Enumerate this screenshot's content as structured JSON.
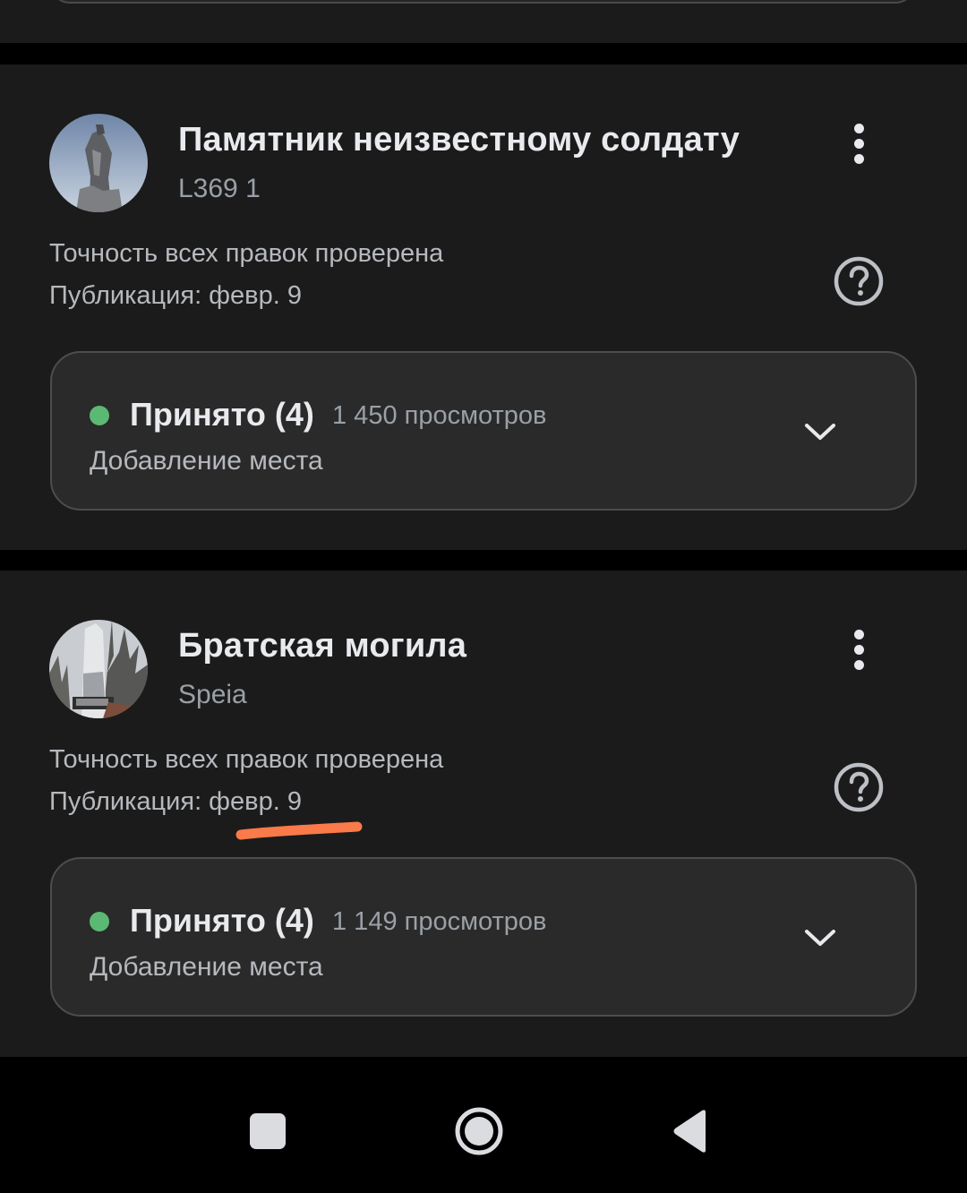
{
  "colors": {
    "background": "#000000",
    "card": "#1b1b1b",
    "status_box": "#2a2a2a",
    "accepted_green": "#5bb974",
    "highlight_orange": "#fa7a4a"
  },
  "places": [
    {
      "title": "Памятник неизвестному солдату",
      "subtitle": "L369 1",
      "accuracy": "Точность всех правок проверена",
      "published": "Публикация: февр. 9",
      "status": "Принято (4)",
      "views": "1 450 просмотров",
      "edit_type": "Добавление места",
      "icons": {
        "menu": "more-vert-icon",
        "help": "help-circle-icon",
        "expand": "chevron-down-icon"
      }
    },
    {
      "title": "Братская могила",
      "subtitle": "Speia",
      "accuracy": "Точность всех правок проверена",
      "published": "Публикация: февр. 9",
      "status": "Принято (4)",
      "views": "1 149 просмотров",
      "edit_type": "Добавление места",
      "icons": {
        "menu": "more-vert-icon",
        "help": "help-circle-icon",
        "expand": "chevron-down-icon"
      }
    }
  ],
  "navbar": {
    "icons": [
      "recent-apps-icon",
      "home-icon",
      "back-icon"
    ]
  }
}
